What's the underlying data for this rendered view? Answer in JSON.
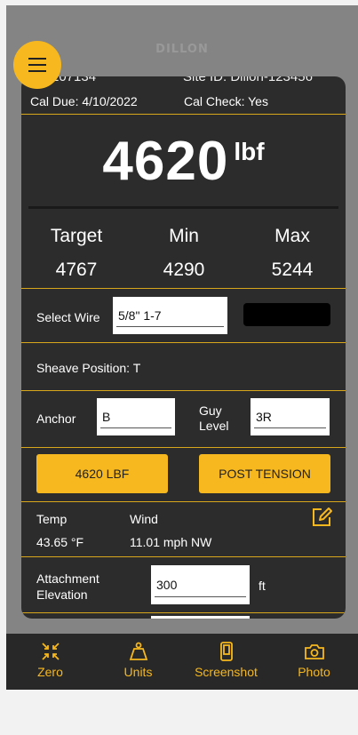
{
  "app": {
    "brand": "DILLON"
  },
  "info": {
    "device_id_cut": "107134",
    "site_id_cut": "Site ID: Dillon-123456",
    "cal_due": "Cal Due:  4/10/2022",
    "cal_check": "Cal Check: Yes"
  },
  "reading": {
    "value": "4620",
    "unit": "lbf"
  },
  "targets": {
    "target_label": "Target",
    "target_value": "4767",
    "min_label": "Min",
    "min_value": "4290",
    "max_label": "Max",
    "max_value": "5244"
  },
  "wire": {
    "label": "Select Wire",
    "value": "5/8\" 1-7"
  },
  "sheave": {
    "label": "Sheave Position:  T"
  },
  "anchor": {
    "label": "Anchor",
    "value": "B"
  },
  "guy_level": {
    "label_line1": "Guy",
    "label_line2": "Level",
    "value": "3R"
  },
  "buttons": {
    "record_label": "4620 LBF",
    "post_tension_label": "POST TENSION"
  },
  "weather": {
    "temp_label": "Temp",
    "temp_value": "43.65 °F",
    "wind_label": "Wind",
    "wind_value": "11.01 mph  NW"
  },
  "attachment": {
    "label_line1": "Attachment",
    "label_line2": "Elevation",
    "value": "300",
    "unit": "ft"
  },
  "nav": {
    "zero": "Zero",
    "units": "Units",
    "screenshot": "Screenshot",
    "photo": "Photo"
  },
  "colors": {
    "accent": "#f6b81e",
    "card": "#2c2c2c",
    "divider": "#d9a71c"
  }
}
